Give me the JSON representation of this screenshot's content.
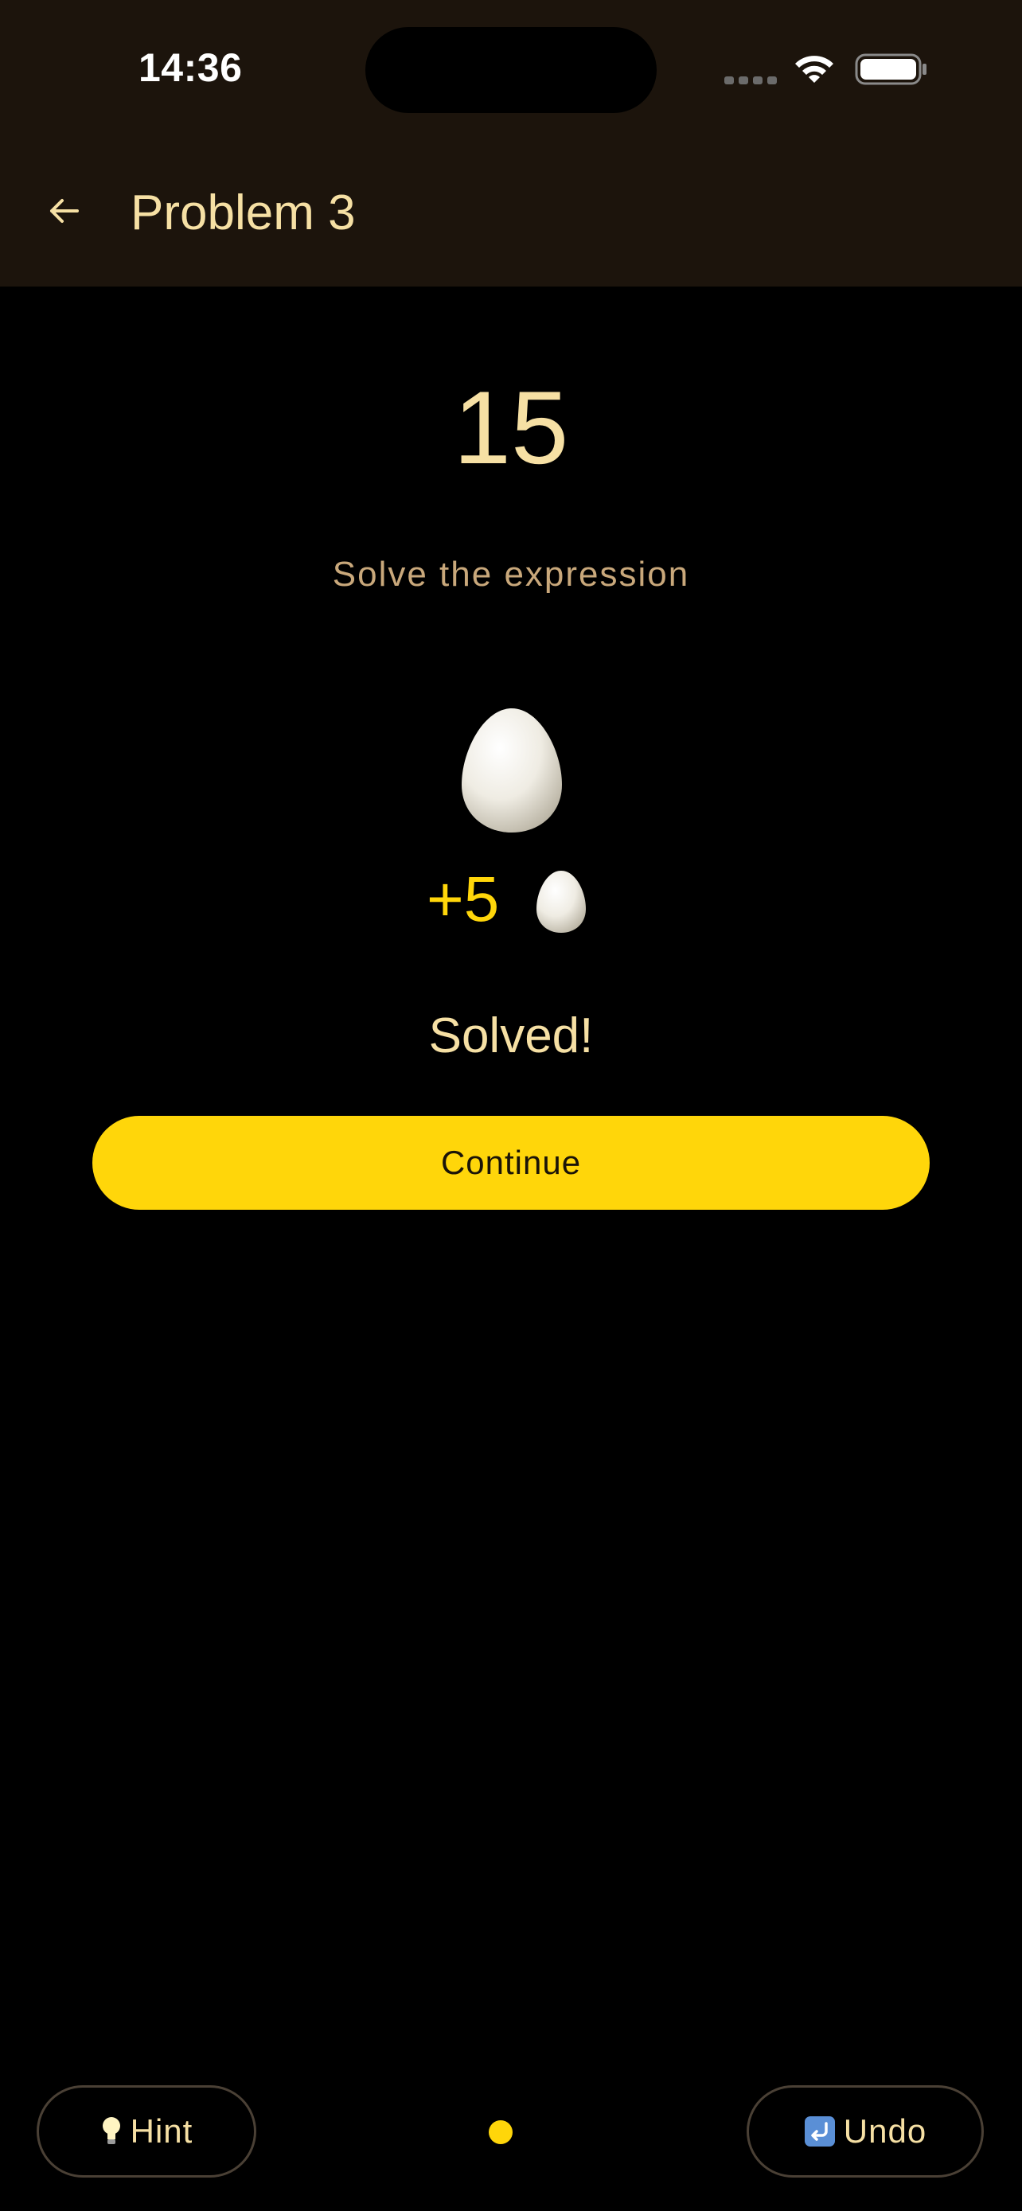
{
  "status_bar": {
    "time": "14:36"
  },
  "header": {
    "back_icon": "arrow-left-icon",
    "title": "Problem 3"
  },
  "problem": {
    "target": "15",
    "instruction": "Solve the expression"
  },
  "reward": {
    "egg_icon": "egg-icon",
    "amount": "+5"
  },
  "result": {
    "status": "Solved!",
    "continue_label": "Continue"
  },
  "footer": {
    "hint_icon": "lightbulb-icon",
    "hint_label": "Hint",
    "undo_icon": "undo-arrow-icon",
    "undo_label": "Undo",
    "page_indicator": {
      "total": 1,
      "active": 1
    }
  },
  "colors": {
    "accent": "#ffd60a",
    "text_primary": "#f6e0a4",
    "text_secondary": "#c9a87b",
    "header_bg": "#1c140c",
    "background": "#000000"
  }
}
